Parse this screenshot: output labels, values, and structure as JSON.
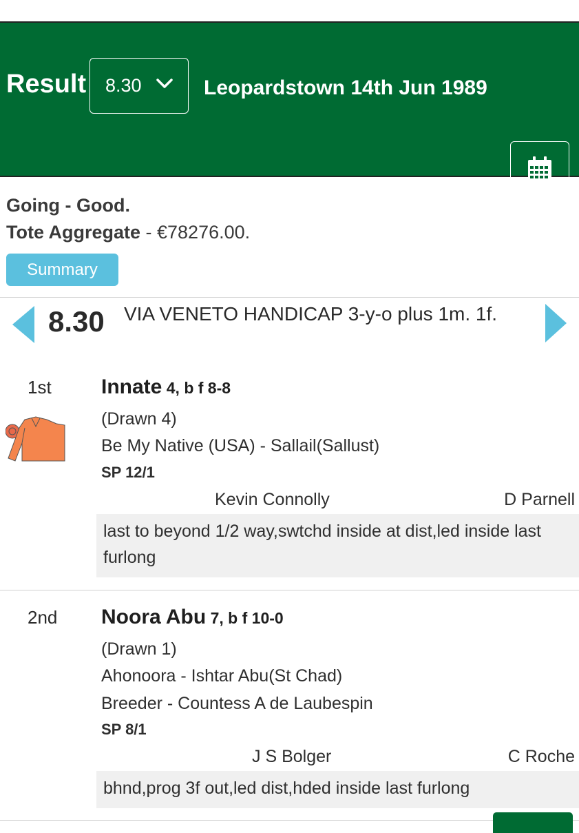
{
  "header": {
    "title": "Result",
    "race_select_value": "8.30",
    "meeting": "Leopardstown 14th Jun 1989"
  },
  "info": {
    "going_label": "Going - Good.",
    "tote_label": "Tote Aggregate",
    "tote_value": " - €78276.00."
  },
  "summary_label": "Summary",
  "race": {
    "time": "8.30",
    "name": "VIA VENETO HANDICAP 3-y-o plus 1m. 1f."
  },
  "runners": [
    {
      "position": "1st",
      "name": "Innate",
      "age_weight": " 4, b f 8-8",
      "draw": "(Drawn 4)",
      "breeding": "Be My Native (USA) - Sallail(Sallust)",
      "sp": "SP 12/1",
      "trainer": "Kevin Connolly",
      "jockey": "D Parnell",
      "comment": "last to beyond 1/2 way,swtchd inside at dist,led inside last furlong"
    },
    {
      "position": "2nd",
      "name": "Noora Abu",
      "age_weight": " 7, b f 10-0",
      "draw": "(Drawn 1)",
      "breeding": "Ahonoora - Ishtar Abu(St Chad)",
      "breeder": "Breeder - Countess A de Laubespin",
      "sp": "SP 8/1",
      "trainer": "J S Bolger",
      "jockey": "C Roche",
      "comment": "bhnd,prog 3f out,led dist,hded inside last furlong"
    }
  ],
  "colors": {
    "header_green": "#006b33",
    "summary_blue": "#5bc0de",
    "arrow_blue": "#5bc0de",
    "silks_orange": "#f4854d"
  },
  "icons": [
    "chevron-down-icon",
    "calendar-icon",
    "arrow-left-icon",
    "arrow-right-icon",
    "silks-icon"
  ]
}
